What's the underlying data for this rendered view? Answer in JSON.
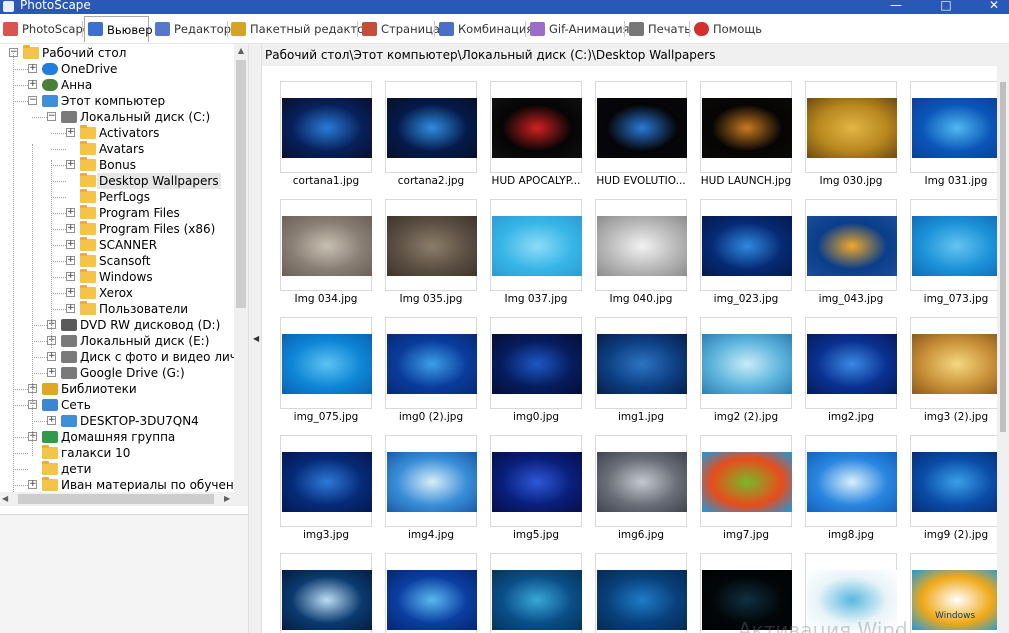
{
  "window": {
    "title": "PhotoScape",
    "minimize": "—",
    "maximize": "□",
    "close": "✕"
  },
  "tabs": [
    {
      "label": "PhotoScape",
      "icon": "photoscape-icon",
      "color": "#d9534f"
    },
    {
      "label": "Вьювер",
      "icon": "viewer-icon",
      "color": "#3b6fd0",
      "active": true
    },
    {
      "label": "Редактор",
      "icon": "editor-icon",
      "color": "#5577cc"
    },
    {
      "label": "Пакетный редактор",
      "icon": "batch-editor-icon",
      "color": "#d6a325"
    },
    {
      "label": "Страница",
      "icon": "page-icon",
      "color": "#c24f3a"
    },
    {
      "label": "Комбинация",
      "icon": "combine-icon",
      "color": "#4a6fc8"
    },
    {
      "label": "Gif-Анимация",
      "icon": "gif-icon",
      "color": "#9c6dc8"
    },
    {
      "label": "Печать",
      "icon": "printer-icon",
      "color": "#777777"
    },
    {
      "label": "Помощь",
      "icon": "help-icon",
      "color": "#d32f2f"
    }
  ],
  "tree": {
    "nodes": [
      {
        "label": "Рабочий стол",
        "icon": "folder-icon",
        "level": 0,
        "expander": "−"
      },
      {
        "label": "OneDrive",
        "icon": "cloud-icon",
        "level": 1,
        "expander": "+"
      },
      {
        "label": "Анна",
        "icon": "user-icon",
        "level": 1,
        "expander": "+"
      },
      {
        "label": "Этот компьютер",
        "icon": "computer-icon",
        "level": 1,
        "expander": "−"
      },
      {
        "label": "Локальный диск (C:)",
        "icon": "drive-icon",
        "level": 2,
        "expander": "−"
      },
      {
        "label": "Activators",
        "icon": "folder-icon",
        "level": 3,
        "expander": "+"
      },
      {
        "label": "Avatars",
        "icon": "folder-icon",
        "level": 3,
        "expander": ""
      },
      {
        "label": "Bonus",
        "icon": "folder-icon",
        "level": 3,
        "expander": "+"
      },
      {
        "label": "Desktop Wallpapers",
        "icon": "folder-icon",
        "level": 3,
        "expander": "",
        "selected": true
      },
      {
        "label": "PerfLogs",
        "icon": "folder-icon",
        "level": 3,
        "expander": ""
      },
      {
        "label": "Program Files",
        "icon": "folder-icon",
        "level": 3,
        "expander": "+"
      },
      {
        "label": "Program Files (x86)",
        "icon": "folder-icon",
        "level": 3,
        "expander": "+"
      },
      {
        "label": "SCANNER",
        "icon": "folder-icon",
        "level": 3,
        "expander": "+"
      },
      {
        "label": "Scansoft",
        "icon": "folder-icon",
        "level": 3,
        "expander": "+"
      },
      {
        "label": "Windows",
        "icon": "folder-icon",
        "level": 3,
        "expander": "+"
      },
      {
        "label": "Xerox",
        "icon": "folder-icon",
        "level": 3,
        "expander": "+"
      },
      {
        "label": "Пользователи",
        "icon": "folder-icon",
        "level": 3,
        "expander": "+"
      },
      {
        "label": "DVD RW дисковод (D:)",
        "icon": "dvd-drive-icon",
        "level": 2,
        "expander": "+"
      },
      {
        "label": "Локальный диск (E:)",
        "icon": "drive-icon",
        "level": 2,
        "expander": "+"
      },
      {
        "label": "Диск с фото и видео личн",
        "icon": "drive-icon",
        "level": 2,
        "expander": "+"
      },
      {
        "label": "Google Drive (G:)",
        "icon": "drive-icon",
        "level": 2,
        "expander": "+"
      },
      {
        "label": "Библиотеки",
        "icon": "libraries-icon",
        "level": 1,
        "expander": "+"
      },
      {
        "label": "Сеть",
        "icon": "network-icon",
        "level": 1,
        "expander": "−"
      },
      {
        "label": "DESKTOP-3DU7QN4",
        "icon": "computer-icon",
        "level": 2,
        "expander": "+"
      },
      {
        "label": "Домашняя группа",
        "icon": "homegroup-icon",
        "level": 1,
        "expander": "+"
      },
      {
        "label": "галакси 10",
        "icon": "folder-icon",
        "level": 1,
        "expander": ""
      },
      {
        "label": "дети",
        "icon": "folder-icon",
        "level": 1,
        "expander": ""
      },
      {
        "label": "Иван материалы по обучению",
        "icon": "folder-icon",
        "level": 1,
        "expander": "+"
      }
    ]
  },
  "path": "Рабочий стол\\Этот компьютер\\Локальный диск (C:)\\Desktop Wallpapers",
  "files": [
    {
      "name": "cortana1.jpg",
      "colors": [
        "#07205a",
        "#2a7bd8",
        "#0a1030"
      ]
    },
    {
      "name": "cortana2.jpg",
      "colors": [
        "#051a4a",
        "#2f8ee0",
        "#061028"
      ]
    },
    {
      "name": "HUD APOCALYP...",
      "colors": [
        "#050505",
        "#d02020",
        "#101010"
      ]
    },
    {
      "name": "HUD EVOLUTIO...",
      "colors": [
        "#050508",
        "#2a7ad8",
        "#08080c"
      ]
    },
    {
      "name": "HUD LAUNCH.jpg",
      "colors": [
        "#060504",
        "#c87a20",
        "#0c0a08"
      ]
    },
    {
      "name": "Img 030.jpg",
      "colors": [
        "#b8861e",
        "#e2b646",
        "#6e4a10"
      ]
    },
    {
      "name": "Img 031.jpg",
      "colors": [
        "#0a56b8",
        "#52b8f0",
        "#0b3f9a"
      ]
    },
    {
      "name": "Img 034.jpg",
      "colors": [
        "#8a7f74",
        "#c9c0b4",
        "#6a6058"
      ]
    },
    {
      "name": "Img 035.jpg",
      "colors": [
        "#5c5044",
        "#8c7d6a",
        "#3e3428"
      ]
    },
    {
      "name": "Img 037.jpg",
      "colors": [
        "#38b6e8",
        "#8fdcf6",
        "#2a9cd2"
      ]
    },
    {
      "name": "Img 040.jpg",
      "colors": [
        "#b8b8b8",
        "#f2f2f2",
        "#8c8c8c"
      ]
    },
    {
      "name": "img_023.jpg",
      "colors": [
        "#062a74",
        "#2e8ae0",
        "#041a4e"
      ]
    },
    {
      "name": "img_043.jpg",
      "colors": [
        "#0a3e8a",
        "#f0a828",
        "#1a4c9a"
      ]
    },
    {
      "name": "img_073.jpg",
      "colors": [
        "#1c92d8",
        "#64c4f0",
        "#0e6cb8"
      ]
    },
    {
      "name": "img_075.jpg",
      "colors": [
        "#0e86d6",
        "#5ec2f2",
        "#0a62b0"
      ]
    },
    {
      "name": "img0 (2).jpg",
      "colors": [
        "#0a3c9c",
        "#3ca0e8",
        "#062a74"
      ]
    },
    {
      "name": "img0.jpg",
      "colors": [
        "#061c5c",
        "#1c58c4",
        "#040f38"
      ]
    },
    {
      "name": "img1.jpg",
      "colors": [
        "#0c3f82",
        "#2e74c2",
        "#071e4a"
      ]
    },
    {
      "name": "img2 (2).jpg",
      "colors": [
        "#5cb4dc",
        "#c8ecf8",
        "#2e7eb0"
      ]
    },
    {
      "name": "img2.jpg",
      "colors": [
        "#0a3090",
        "#3a8ae4",
        "#041c5c"
      ]
    },
    {
      "name": "img3 (2).jpg",
      "colors": [
        "#c89038",
        "#f4d880",
        "#8a5a1c"
      ]
    },
    {
      "name": "img3.jpg",
      "colors": [
        "#062a78",
        "#2c7ad8",
        "#041852"
      ]
    },
    {
      "name": "img4.jpg",
      "colors": [
        "#3a8ed8",
        "#d8eef8",
        "#1a5aa8"
      ]
    },
    {
      "name": "img5.jpg",
      "colors": [
        "#0a1e7a",
        "#2c58d8",
        "#06104c"
      ]
    },
    {
      "name": "img6.jpg",
      "colors": [
        "#6a6e78",
        "#c4c8d0",
        "#404450"
      ]
    },
    {
      "name": "img7.jpg",
      "colors": [
        "#e84d1c",
        "#78b82a",
        "#1a9ae0"
      ]
    },
    {
      "name": "img8.jpg",
      "colors": [
        "#2a86e0",
        "#d8f0fc",
        "#1262c0"
      ]
    },
    {
      "name": "img9 (2).jpg",
      "colors": [
        "#0a4ca8",
        "#3aa0e8",
        "#062e78"
      ]
    },
    {
      "name": "",
      "colors": [
        "#0a3a6e",
        "#bcdcf4",
        "#061c40"
      ]
    },
    {
      "name": "",
      "colors": [
        "#0a3ea0",
        "#5cb8f2",
        "#062672"
      ]
    },
    {
      "name": "",
      "colors": [
        "#0a4e88",
        "#38a8d8",
        "#063458"
      ]
    },
    {
      "name": "",
      "colors": [
        "#08407a",
        "#1e7cc8",
        "#052a54"
      ]
    },
    {
      "name": "",
      "colors": [
        "#020608",
        "#0e3040",
        "#010304"
      ]
    },
    {
      "name": "",
      "colors": [
        "#e8f4f8",
        "#58b8e0",
        "#ffffff"
      ]
    },
    {
      "name": "",
      "colors": [
        "#f0a818",
        "#ffffff",
        "#1a9ae0"
      ]
    }
  ],
  "partial_texts": {
    "windows_label": "Windows",
    "watermark": "Активация Wind"
  }
}
